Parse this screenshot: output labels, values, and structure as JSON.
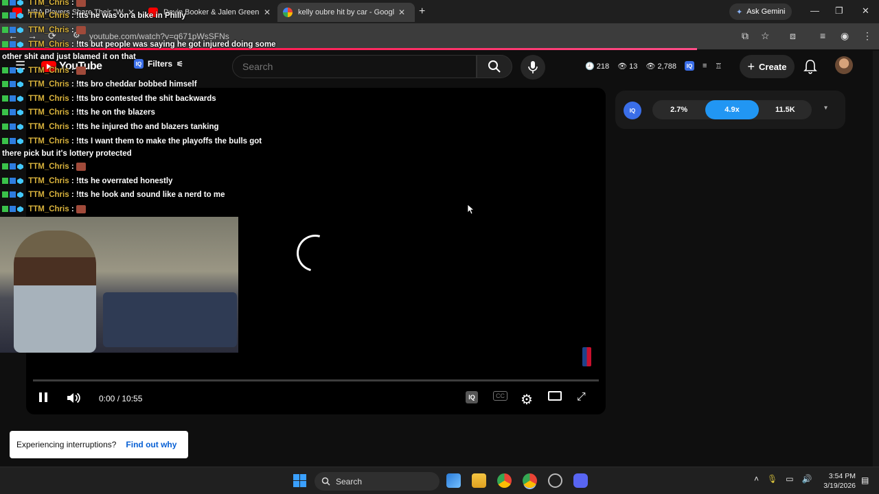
{
  "browser": {
    "tabs": [
      {
        "title": "NBA Players Share Their \"Welco",
        "favicon": "youtube-icon"
      },
      {
        "title": "Devin Booker & Jalen Green Of",
        "favicon": "youtube-icon"
      },
      {
        "title": "kelly oubre hit by car - Google",
        "favicon": "google-icon"
      }
    ],
    "active_tab": 2,
    "ask_gemini_label": "Ask Gemini",
    "url": "youtube.com/watch?v=q671pWsSFNs"
  },
  "youtube": {
    "logo_text": "YouTube",
    "filters_label": "Filters",
    "iq_label": "IQ",
    "search_placeholder": "Search",
    "stats": {
      "time": "218",
      "views": "13",
      "watch": "2,788"
    },
    "create_label": "Create"
  },
  "chat": [
    {
      "user": "TTM_Chris",
      "msg": "",
      "emote": true
    },
    {
      "user": "TTM_Chris",
      "msg": "!tts he was on a bike in Philly",
      "emote": false
    },
    {
      "user": "TTM_Chris",
      "msg": "",
      "emote": true
    },
    {
      "user": "TTM_Chris",
      "msg": "!tts but people was saying he got injured doing some other shit and just blamed it on that",
      "emote": false
    },
    {
      "user": "TTM_Chris",
      "msg": "",
      "emote": true
    },
    {
      "user": "TTM_Chris",
      "msg": "!tts bro cheddar bobbed himself",
      "emote": false
    },
    {
      "user": "TTM_Chris",
      "msg": "!tts bro contested the shit backwards",
      "emote": false
    },
    {
      "user": "TTM_Chris",
      "msg": "!tts he on the blazers",
      "emote": false
    },
    {
      "user": "TTM_Chris",
      "msg": "!tts he injured tho and blazers tanking",
      "emote": false
    },
    {
      "user": "TTM_Chris",
      "msg": "!tts I want them to make the playoffs the bulls got there pick but it's lottery protected",
      "emote": false
    },
    {
      "user": "TTM_Chris",
      "msg": "",
      "emote": true
    },
    {
      "user": "TTM_Chris",
      "msg": "!tts he overrated honestly",
      "emote": false
    },
    {
      "user": "TTM_Chris",
      "msg": "!tts he look and sound like a nerd to me",
      "emote": false
    },
    {
      "user": "TTM_Chris",
      "msg": "",
      "emote": true
    }
  ],
  "player": {
    "timecode": "0:00 / 10:55",
    "progress": 0
  },
  "iq_panel": {
    "logo": "IQ",
    "pills": [
      "2.7%",
      "4.9x",
      "11.5K"
    ],
    "active_pill": 1
  },
  "toast": {
    "text": "Experiencing interruptions?",
    "link": "Find out why"
  },
  "taskbar": {
    "search_label": "Search",
    "time": "3:54 PM",
    "date": "3/19/2026"
  },
  "colors": {
    "accent_red": "#ff0000",
    "pill_active": "#2196f3",
    "chat_user": "#d8b23c",
    "link_blue": "#065fd4"
  }
}
